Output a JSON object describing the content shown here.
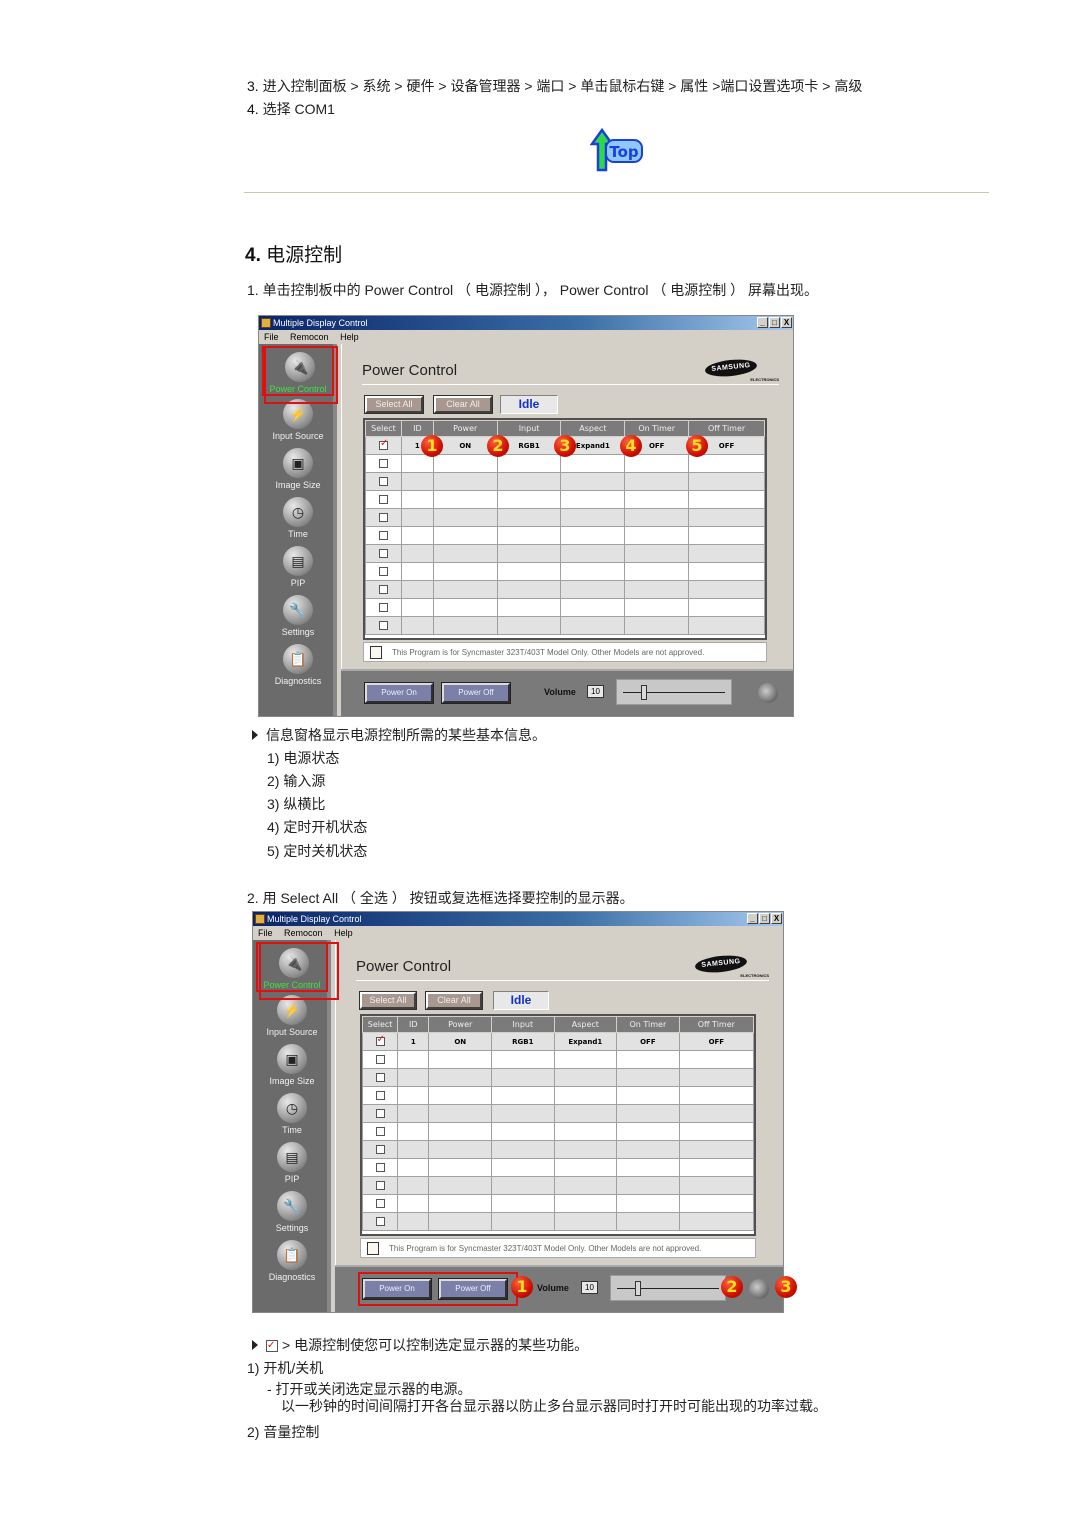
{
  "steps_top": [
    {
      "num": "3.",
      "text": "进入控制面板 > 系统 > 硬件 > 设备管理器 > 端口 > 单击鼠标右键 > 属性 >端口设置选项卡 > 高级"
    },
    {
      "num": "4.",
      "text": "选择 COM1"
    }
  ],
  "top_link": {
    "label": "Top",
    "icon": "top-arrow-icon"
  },
  "section": {
    "number": "4.",
    "title": "电源控制"
  },
  "step1": {
    "num": "1.",
    "text": "单击控制板中的 Power Control （ 电源控制 ）， Power Control （ 电源控制 ） 屏幕出现。"
  },
  "app": {
    "window_title": "Multiple Display Control",
    "menu": [
      "File",
      "Remocon",
      "Help"
    ],
    "window_buttons": [
      "_",
      "□",
      "X"
    ],
    "sidebar": [
      {
        "label": "Power Control",
        "icon": "power-plug-icon",
        "active": true
      },
      {
        "label": "Input Source",
        "icon": "input-cable-icon",
        "active": false
      },
      {
        "label": "Image Size",
        "icon": "monitor-icon",
        "active": false
      },
      {
        "label": "Time",
        "icon": "clock-icon",
        "active": false
      },
      {
        "label": "PIP",
        "icon": "pip-icon",
        "active": false
      },
      {
        "label": "Settings",
        "icon": "wrench-icon",
        "active": false
      },
      {
        "label": "Diagnostics",
        "icon": "checklist-icon",
        "active": false
      }
    ],
    "panel_title": "Power Control",
    "brand": {
      "name": "SAMSUNG",
      "sub": "ELECTRONICS"
    },
    "select_all_label": "Select All",
    "clear_all_label": "Clear All",
    "status": "Idle",
    "columns": [
      "Select",
      "ID",
      "Power",
      "Input",
      "Aspect",
      "On Timer",
      "Off Timer"
    ],
    "rows": [
      {
        "checked": true,
        "id": "1",
        "power": "ON",
        "input": "RGB1",
        "aspect": "Expand1",
        "on_timer": "OFF",
        "off_timer": "OFF"
      }
    ],
    "empty_rows": 10,
    "notice": "This Program is for Syncmaster 323T/403T Model Only. Other Models are not approved.",
    "power_on_label": "Power On",
    "power_off_label": "Power Off",
    "volume_label": "Volume",
    "volume_value": "10",
    "volume_fraction": 0.1
  },
  "markers_1": [
    "1",
    "2",
    "3",
    "4",
    "5"
  ],
  "info": {
    "lead": "信息窗格显示电源控制所需的某些基本信息。",
    "items": [
      {
        "num": "1)",
        "text": "电源状态"
      },
      {
        "num": "2)",
        "text": "输入源"
      },
      {
        "num": "3)",
        "text": "纵横比"
      },
      {
        "num": "4)",
        "text": "定时开机状态"
      },
      {
        "num": "5)",
        "text": "定时关机状态"
      }
    ]
  },
  "step2": {
    "num": "2.",
    "text": "用 Select All （ 全选 ） 按钮或复选框选择要控制的显示器。"
  },
  "markers_2": [
    "1",
    "2",
    "3"
  ],
  "features": {
    "lead": "> 电源控制使您可以控制选定显示器的某些功能。",
    "item1": {
      "num": "1)",
      "text": "开机/关机"
    },
    "item1_desc1": "- 打开或关闭选定显示器的电源。",
    "item1_desc2": "以一秒钟的时间间隔打开各台显示器以防止多台显示器同时打开时可能出现的功率过载。",
    "item2": {
      "num": "2)",
      "text": "音量控制"
    }
  }
}
